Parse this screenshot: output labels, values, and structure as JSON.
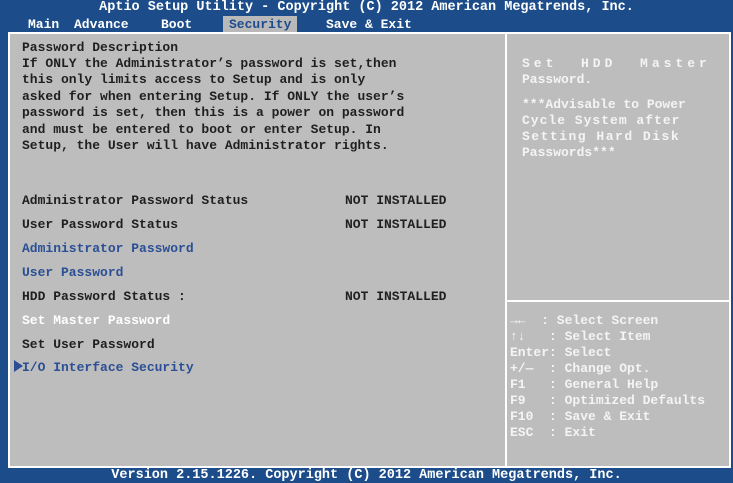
{
  "title": "Aptio Setup Utility - Copyright (C) 2012 American Megatrends, Inc.",
  "menu": {
    "tabs": [
      {
        "label": "Main",
        "active": false
      },
      {
        "label": "Advance",
        "active": false
      },
      {
        "label": "Boot",
        "active": false
      },
      {
        "label": "Security",
        "active": true
      },
      {
        "label": "Save & Exit",
        "active": false
      }
    ]
  },
  "left": {
    "desc_heading": "Password Description",
    "desc_lines": [
      "If ONLY the Administrator’s password is set,then",
      "this only limits access to Setup and is only",
      "asked for when entering Setup. If ONLY the user’s",
      "password is set, then this is a power on password",
      "and must be entered to boot or enter Setup. In",
      "Setup, the User will have Administrator rights."
    ],
    "admin_status_label": "Administrator Password Status",
    "admin_status_value": "NOT INSTALLED",
    "user_status_label": "User Password Status",
    "user_status_value": "NOT INSTALLED",
    "admin_password": "Administrator Password",
    "user_password": "User Password",
    "hdd_status_label": "HDD Password Status :",
    "hdd_status_value": "NOT INSTALLED",
    "set_master": "Set Master Password",
    "set_user": "Set User Password",
    "io_security": "I/O Interface Security"
  },
  "right": {
    "help_lines": [
      "Set  HDD  Master",
      "Password.",
      "",
      "***Advisable to Power",
      "Cycle System after",
      "Setting Hard Disk",
      "Passwords***"
    ],
    "keys": [
      "→←  : Select Screen",
      "↑↓   : Select Item",
      "Enter: Select",
      "+/—  : Change Opt.",
      "F1   : General Help",
      "F9   : Optimized Defaults",
      "F10  : Save & Exit",
      "ESC  : Exit"
    ]
  },
  "footer": "Version 2.15.1226. Copyright (C) 2012 American Megatrends, Inc.",
  "colors": {
    "frame_blue": "#1c4d8a",
    "panel_gray": "#bdbdbd",
    "item_blue": "#2b4f94",
    "highlight_white": "#ffffff"
  }
}
